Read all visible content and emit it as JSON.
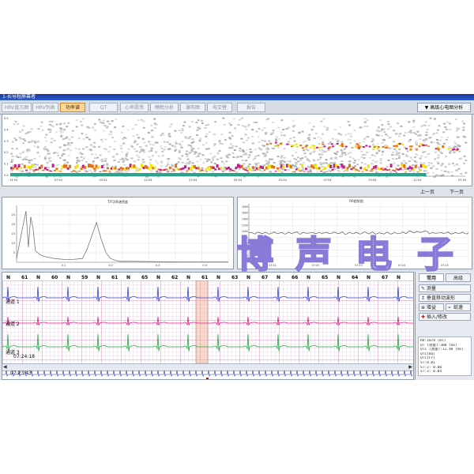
{
  "window": {
    "title": "1-长导程屏幕者"
  },
  "tabs": [
    {
      "label": "HRV直方图",
      "active": false
    },
    {
      "label": "HRV列表",
      "active": false
    },
    {
      "label": "功率谱",
      "active": true
    },
    {
      "label": "QT",
      "active": false
    },
    {
      "label": "心率震荡",
      "active": false
    },
    {
      "label": "睡眠分析",
      "active": false
    },
    {
      "label": "瀑布图",
      "active": false
    },
    {
      "label": "电交替",
      "active": false
    },
    {
      "label": "报告",
      "active": false
    }
  ],
  "advanced_button": {
    "label": "高级心电图分析",
    "icon": "triangle-down-icon"
  },
  "pager": {
    "prev": "上一页",
    "next": "下一页"
  },
  "channels": [
    "通道 1",
    "通道 2",
    "通道 3"
  ],
  "time_markers": [
    "07:24:18",
    "07:23:43"
  ],
  "right_panel": {
    "tabs": [
      {
        "label": "常用",
        "active": true
      },
      {
        "label": "高级",
        "active": false
      }
    ],
    "tools": [
      {
        "label": "测量",
        "icon": "ruler-icon"
      },
      {
        "label": "垂直移动波形",
        "icon": "move-vertical-icon"
      },
      {
        "label": "增益",
        "icon": "zoom-icon"
      },
      {
        "label": "纸速",
        "icon": "speed-icon"
      },
      {
        "label": "插入/修改",
        "icon": "edit-plus-icon"
      }
    ],
    "info": [
      "RR:1078 (ms)",
      "QT (测量):380 (ms)",
      "QTc (测量):11.48 (ms)",
      "QTc(Ba)",
      "QTc(Fr)",
      "ST:0.01",
      "ST:2: 0.00",
      "ST:3: 0.04"
    ]
  },
  "watermark": [
    "博",
    "声",
    "电",
    "子"
  ],
  "chart_data": [
    {
      "type": "heatmap",
      "name": "power-spectrum-waterfall",
      "x_ticks": [
        "13:54",
        "07:54",
        "03:54",
        "22:54",
        "23:54",
        "05:54",
        "01:54",
        "07:54",
        "03:54",
        "11:54",
        "07:54"
      ],
      "y_ticks": [
        "0.5",
        "0.4",
        "0.3",
        "0.2",
        "0.1",
        "0.0"
      ],
      "ylim": [
        0,
        0.5
      ],
      "band_color_low": "#f2e600",
      "band_color_mid": "#e87010",
      "band_color_high": "#c0208a",
      "band_color_base": "#20a890",
      "trend_y": [
        0.04,
        0.045,
        0.05,
        0.05,
        0.06,
        0.05,
        0.05,
        0.06,
        0.05,
        0.06,
        0.07,
        0.06,
        0.06,
        0.07,
        0.06,
        0.05,
        0.06,
        0.06,
        0.07,
        0.27,
        0.27,
        0.26,
        0.25,
        0.26,
        0.27,
        0.26,
        0.25,
        0.24,
        0.26,
        0.25,
        0.26,
        0.24,
        0.23,
        0.04
      ]
    },
    {
      "type": "line",
      "name": "spectrum-density",
      "title": "T/F功率谱密度",
      "x_ticks": [
        "0.1",
        "0.2",
        "0.3",
        "0.4"
      ],
      "y_ticks": [
        "25",
        "20",
        "15",
        "10",
        "5"
      ],
      "xlim": [
        0,
        0.45
      ],
      "ylim": [
        0,
        30
      ],
      "x": [
        0.0,
        0.01,
        0.02,
        0.025,
        0.03,
        0.035,
        0.04,
        0.05,
        0.06,
        0.07,
        0.08,
        0.1,
        0.12,
        0.14,
        0.15,
        0.16,
        0.17,
        0.18,
        0.19,
        0.2,
        0.21,
        0.22,
        0.25,
        0.3,
        0.35,
        0.4,
        0.45
      ],
      "y": [
        2,
        15,
        27,
        8,
        24,
        18,
        6,
        4,
        3,
        2.5,
        2,
        1.5,
        1.5,
        2,
        7,
        14,
        21,
        12,
        5,
        2,
        1,
        0.5,
        0.5,
        0.3,
        0.2,
        0.2,
        0.2
      ]
    },
    {
      "type": "line",
      "name": "rr-trend",
      "title": "RR趋势图",
      "y_ticks": [
        "1800",
        "1600",
        "1400",
        "1200",
        "1000",
        "800",
        "600",
        "400",
        "200"
      ],
      "x_ticks": [
        "07:21",
        "07:22",
        "07:23",
        "07:24",
        "07:25"
      ],
      "ylim": [
        0,
        1900
      ],
      "baseline": 950,
      "variation": 35
    }
  ],
  "beats": {
    "labels": [
      "N",
      "61",
      "N",
      "60",
      "N",
      "59",
      "N",
      "61",
      "N",
      "65",
      "N",
      "62",
      "N",
      "61",
      "N",
      "63",
      "N",
      "67",
      "N",
      "66",
      "N",
      "65",
      "N",
      "64",
      "N",
      "67",
      "N"
    ],
    "highlight_index": 13
  }
}
